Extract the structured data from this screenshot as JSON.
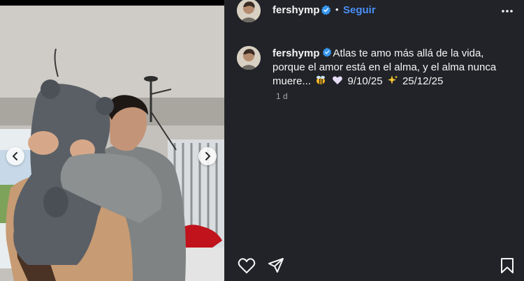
{
  "header": {
    "username": "fershymp",
    "separator": "•",
    "follow_label": "Seguir",
    "avatar_icon": "profile-avatar",
    "verified_icon": "verified-badge-icon",
    "more_icon": "more-options-icon"
  },
  "caption": {
    "username": "fershymp",
    "text_part1": "Atlas te amo más allá de la vida, porque el amor está en el alma, y el alma nunca muere...",
    "emoji1": "bee-emoji",
    "emoji2": "white-heart-emoji",
    "date1": "9/10/25",
    "emoji3": "sparkles-emoji",
    "date2": "25/12/25"
  },
  "timestamp": "1 d",
  "media": {
    "prev_icon": "chevron-left-icon",
    "next_icon": "chevron-right-icon"
  },
  "actions": {
    "like_icon": "heart-icon",
    "share_icon": "send-icon",
    "save_icon": "bookmark-icon"
  },
  "colors": {
    "panel_bg": "#212328",
    "accent": "#4a8ff7",
    "verified": "#3797f0",
    "muted_text": "#a8a8a8"
  }
}
